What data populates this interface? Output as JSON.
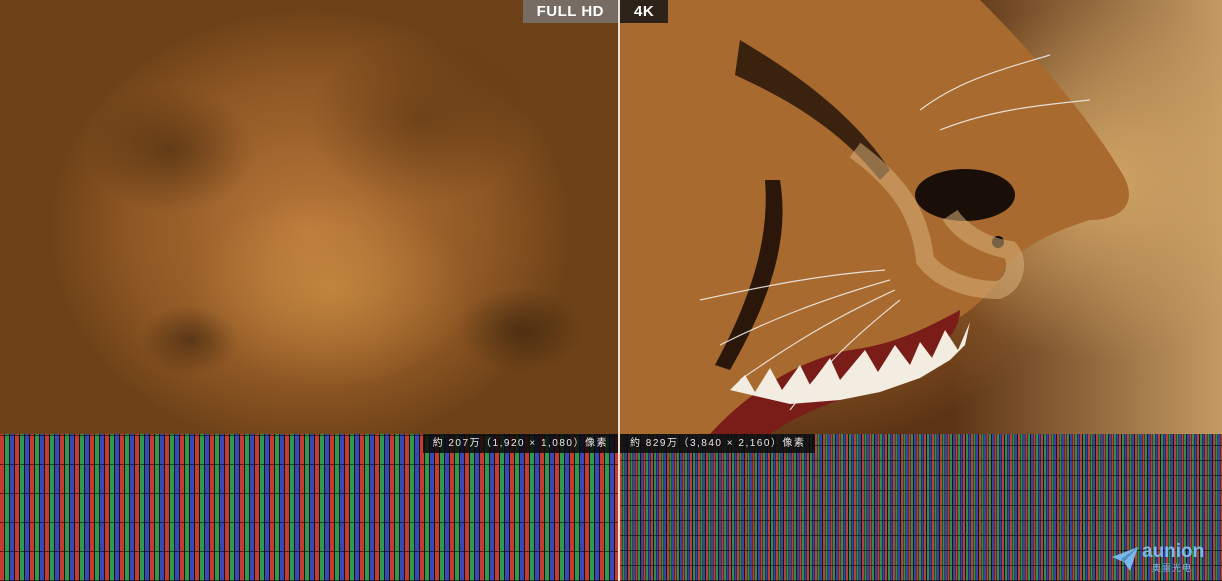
{
  "left_panel": {
    "badge": "FULL HD",
    "caption": "約 207万（1,920 × 1,080）像素"
  },
  "right_panel": {
    "badge": "4K",
    "caption": "約 829万（3,840 × 2,160）像素"
  },
  "logo": {
    "name": "aunion",
    "subtitle": "奥雷光电",
    "icon": "paper-plane-icon",
    "color": "#7ab8ea"
  },
  "colors": {
    "subpixel_red": "#c73a32",
    "subpixel_green": "#2f9a4e",
    "subpixel_blue": "#3848b8"
  }
}
